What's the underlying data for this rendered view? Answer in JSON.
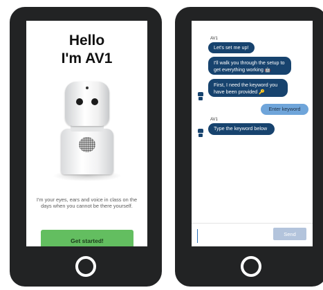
{
  "welcome_screen": {
    "title_line1": "Hello",
    "title_line2": "I'm AV1",
    "intro_text": "I'm your eyes, ears and voice in class on the days when you cannot be there yourself.",
    "cta_label": "Get started!",
    "accent_color": "#63be60"
  },
  "chat_screen": {
    "messages": [
      {
        "sender": "AV1",
        "text": "Let's set me up!"
      },
      {
        "text": "I'll walk you through the setup to get everything working",
        "emoji": "robot"
      },
      {
        "text": "First, I need the keyword you have been provided",
        "emoji": "key"
      },
      {
        "sender": "user",
        "text": "Enter keyword"
      },
      {
        "sender": "AV1",
        "text": "Type the keyword below"
      }
    ],
    "input_placeholder": "",
    "send_label": "Send",
    "bot_bubble_color": "#17436e",
    "user_bubble_color": "#6fa5da"
  }
}
